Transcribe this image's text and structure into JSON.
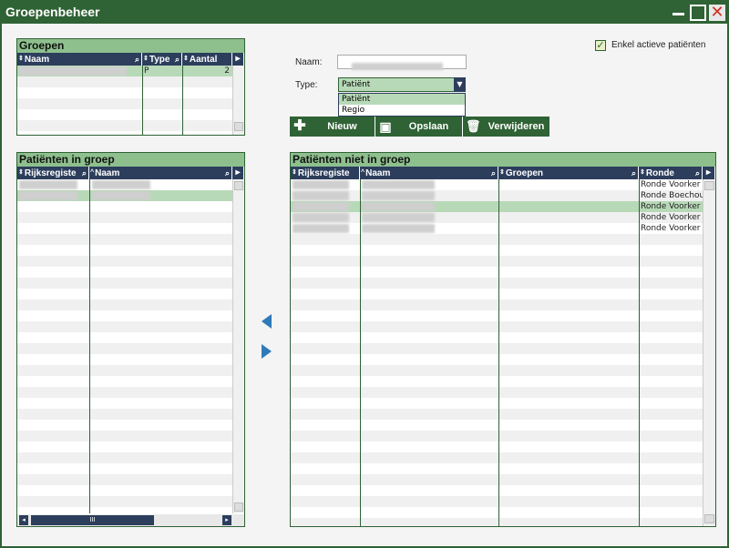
{
  "window": {
    "title": "Groepenbeheer"
  },
  "filter": {
    "label": "Enkel actieve patiënten",
    "checked": true
  },
  "form": {
    "name_label": "Naam:",
    "type_label": "Type:",
    "type_value": "Patiënt",
    "type_options": [
      "Patiënt",
      "Regio"
    ]
  },
  "buttons": {
    "new": "Nieuw",
    "save": "Opslaan",
    "delete": "Verwijderen"
  },
  "groups": {
    "title": "Groepen",
    "columns": [
      "Naam",
      "Type",
      "Aantal"
    ],
    "rows": [
      {
        "type": "P",
        "aantal": "2"
      }
    ]
  },
  "in_group": {
    "title": "Patiënten in groep",
    "columns": [
      "Rijksregiste",
      "Naam"
    ]
  },
  "not_in_group": {
    "title": "Patiënten niet in groep",
    "columns": [
      "Rijksregiste",
      "Naam",
      "Groepen",
      "Ronde"
    ],
    "ronde": [
      "Ronde Voorker",
      "Ronde Boechou",
      "Ronde Voorker",
      "Ronde Voorker",
      "Ronde Voorker"
    ]
  },
  "scroll": {
    "thumb_label": "III"
  }
}
